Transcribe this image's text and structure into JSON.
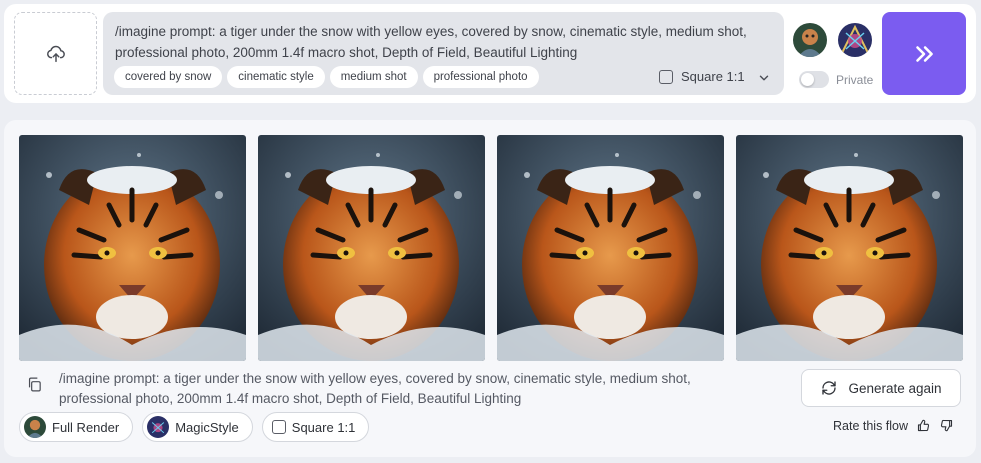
{
  "prompt_bar": {
    "text": "/imagine prompt: a tiger under the snow with yellow eyes, covered by snow, cinematic style, medium shot, professional photo, 200mm 1.4f macro shot, Depth of Field, Beautiful Lighting",
    "chips": [
      "covered by snow",
      "cinematic style",
      "medium shot",
      "professional photo"
    ],
    "aspect_label": "Square 1:1",
    "aspect_checked": false,
    "private_label": "Private",
    "private_on": false
  },
  "icons": {
    "upload": "upload-icon",
    "chevron": "chevron-down-icon",
    "send": "double-chevron-right-icon",
    "copy": "copy-icon",
    "regenerate": "refresh-icon",
    "like": "thumbs-up-icon",
    "dislike": "thumbs-down-icon"
  },
  "colors": {
    "accent": "#7b5cf0",
    "panel": "#ffffff",
    "prompt_bg": "#e3e5ea"
  },
  "result": {
    "images": [
      {
        "alt": "tiger 1"
      },
      {
        "alt": "tiger 2"
      },
      {
        "alt": "tiger 3"
      },
      {
        "alt": "tiger 4"
      }
    ],
    "prompt": "/imagine prompt: a tiger under the snow with yellow eyes, covered by snow, cinematic style, medium shot, professional photo, 200mm 1.4f macro shot, Depth of Field, Beautiful Lighting",
    "generate_again_label": "Generate again",
    "chips": {
      "full_render": "Full Render",
      "magic_style": "MagicStyle",
      "square": "Square 1:1"
    },
    "rate_label": "Rate this flow"
  }
}
